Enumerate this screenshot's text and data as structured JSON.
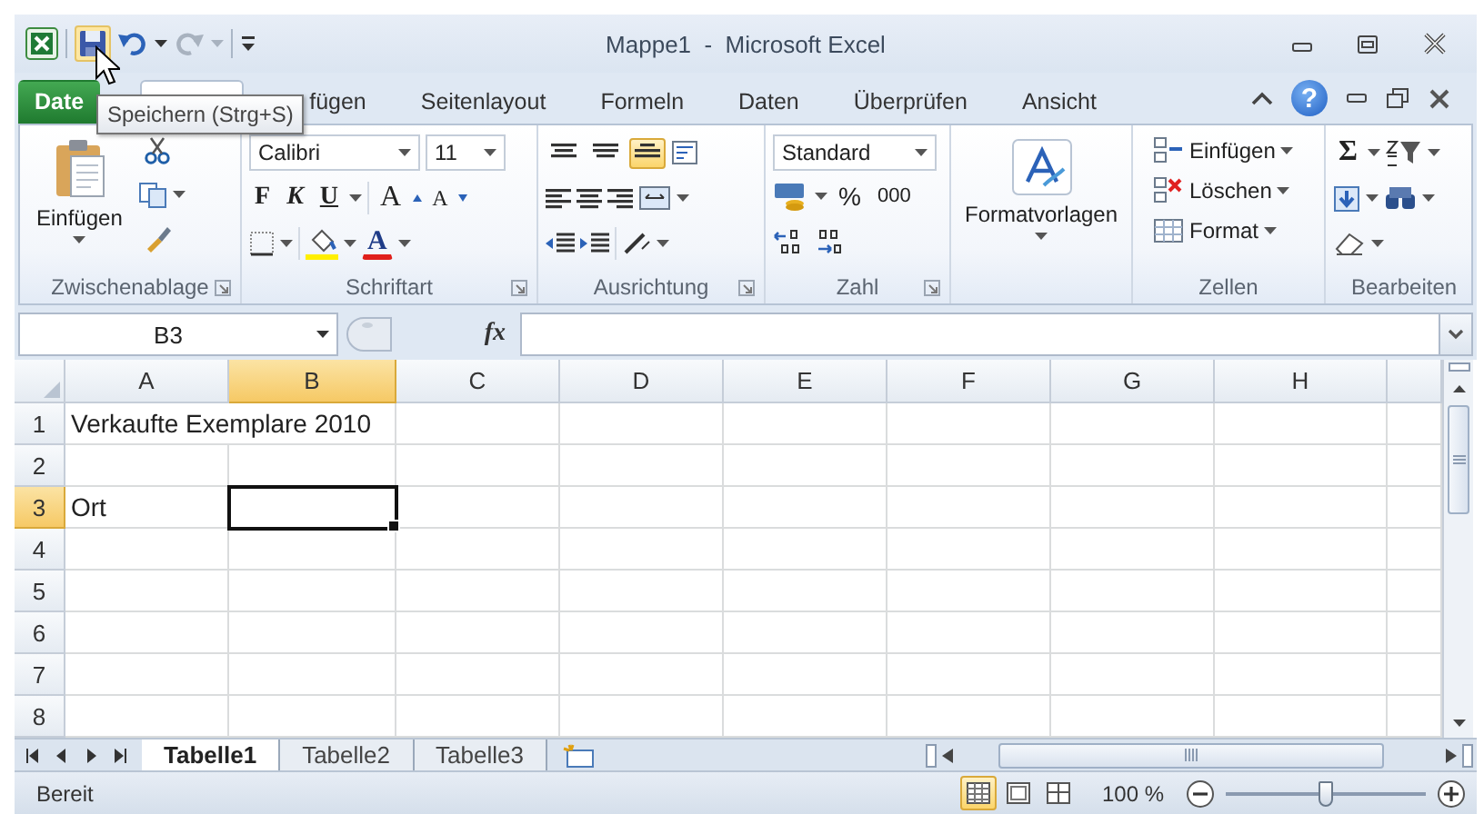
{
  "window": {
    "title": "Mappe1  -  Microsoft Excel"
  },
  "tooltip": "Speichern (Strg+S)",
  "tabs": [
    {
      "kind": "file",
      "label": "Date",
      "selected": false
    },
    {
      "kind": "tab",
      "selected": true
    },
    {
      "kind": "tab",
      "label": "fügen",
      "selected": false
    },
    {
      "kind": "tab",
      "label": "Seitenlayout",
      "selected": false
    },
    {
      "kind": "tab",
      "label": "Formeln",
      "selected": false
    },
    {
      "kind": "tab",
      "label": "Daten",
      "selected": false
    },
    {
      "kind": "tab",
      "label": "Überprüfen",
      "selected": false
    },
    {
      "kind": "tab",
      "label": "Ansicht",
      "selected": false
    }
  ],
  "help": "?",
  "ribbon": [
    {
      "kind": "clipboard",
      "label": "Zwischenablage",
      "launcher": true,
      "paste": "Einfügen"
    },
    {
      "kind": "font",
      "label": "Schriftart",
      "launcher": true,
      "font": "Calibri",
      "size": "11",
      "bold": "F",
      "italic": "K",
      "underline": "U",
      "grow": "A",
      "shrink": "A",
      "font_color": "A"
    },
    {
      "kind": "alignment",
      "label": "Ausrichtung",
      "launcher": true,
      "vertical": [
        {
          "selected": false
        },
        {
          "selected": false
        },
        {
          "selected": true
        }
      ]
    },
    {
      "kind": "number",
      "label": "Zahl",
      "launcher": true,
      "format": "Standard",
      "percent": "%",
      "thousands": "000"
    },
    {
      "kind": "styles",
      "button": "Formatvorlagen"
    },
    {
      "kind": "cells",
      "label": "Zellen",
      "launcher": false,
      "buttons": [
        "Einfügen",
        "Löschen",
        "Format"
      ]
    },
    {
      "kind": "editing",
      "label": "Bearbeiten",
      "launcher": false,
      "sum": "Σ"
    }
  ],
  "name_box": "B3",
  "function_label": "fx",
  "columns": [
    {
      "label": "A",
      "selected": false
    },
    {
      "label": "B",
      "selected": true
    },
    {
      "label": "C",
      "selected": false
    },
    {
      "label": "D",
      "selected": false
    },
    {
      "label": "E",
      "selected": false
    },
    {
      "label": "F",
      "selected": false
    },
    {
      "label": "G",
      "selected": false
    },
    {
      "label": "H",
      "selected": false
    }
  ],
  "rows": [
    {
      "label": "1",
      "selected": false,
      "cells": [
        "Verkaufte Exemplare 2010"
      ]
    },
    {
      "label": "2",
      "selected": false
    },
    {
      "label": "3",
      "selected": true,
      "cells": [
        "Ort"
      ]
    },
    {
      "label": "4",
      "selected": false
    },
    {
      "label": "5",
      "selected": false
    },
    {
      "label": "6",
      "selected": false
    },
    {
      "label": "7",
      "selected": false
    },
    {
      "label": "8",
      "selected": false
    }
  ],
  "sheet_tabs": [
    {
      "label": "Tabelle1",
      "selected": true
    },
    {
      "label": "Tabelle2",
      "selected": false
    },
    {
      "label": "Tabelle3",
      "selected": false
    }
  ],
  "status_bar": {
    "text": "Bereit",
    "views": [
      {
        "selected": true
      },
      {
        "selected": false
      },
      {
        "selected": false
      }
    ],
    "zoom": "100 %",
    "zoom_slider": {
      "level": 0.5
    }
  }
}
